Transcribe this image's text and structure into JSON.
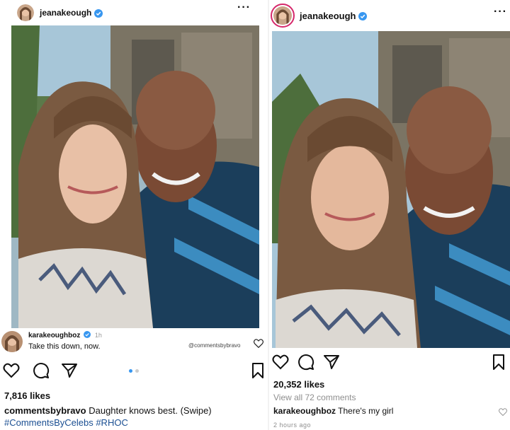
{
  "left_post": {
    "username": "jeanakeough",
    "more_label": "···",
    "comment": {
      "username": "karakeoughboz",
      "time": "1h",
      "text": "Take this down, now.",
      "watermark": "@commentsbybravo"
    },
    "carousel": {
      "current": 1,
      "total": 2
    },
    "likes": "7,816 likes",
    "caption": {
      "username": "commentsbybravo",
      "text": "Daughter knows best. (Swipe)",
      "hashtags": "#CommentsByCelebs #RHOC"
    }
  },
  "right_post": {
    "username": "jeanakeough",
    "more_label": "···",
    "likes": "20,352 likes",
    "view_all": "View all 72 comments",
    "comment": {
      "username": "karakeoughboz",
      "text": "There's my girl"
    },
    "time_ago": "2 hours ago"
  },
  "colors": {
    "verified": "#3897f0",
    "hashtag": "#1b4f92",
    "muted": "#8e8e8e",
    "story_ring": "#d6286b"
  },
  "icons": [
    "heart-icon",
    "comment-icon",
    "share-icon",
    "bookmark-icon",
    "more-icon",
    "verified-icon"
  ]
}
